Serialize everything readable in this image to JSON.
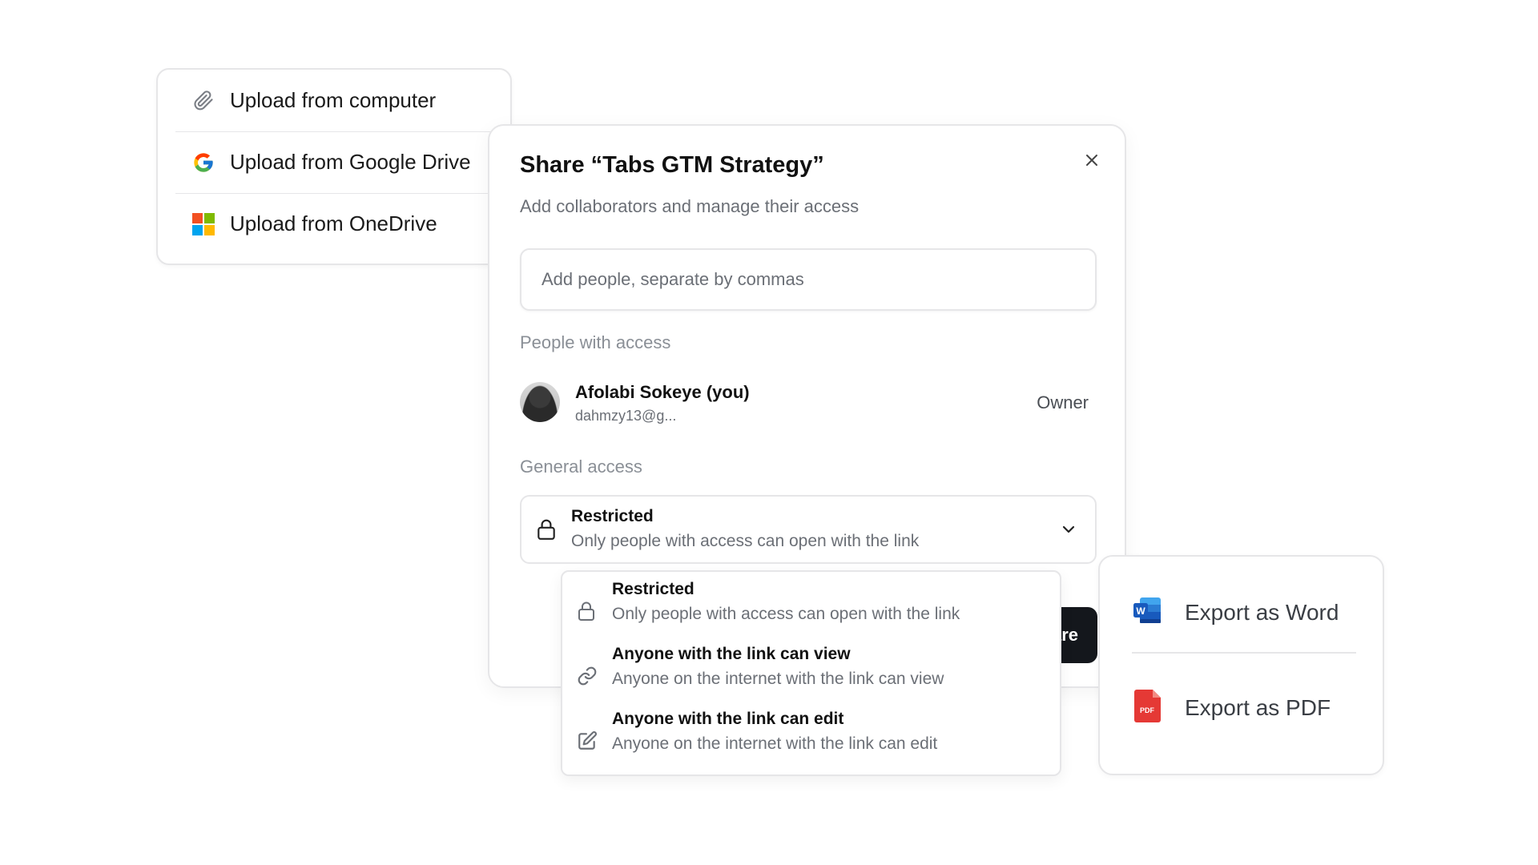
{
  "upload_menu": {
    "items": [
      {
        "label": "Upload from computer",
        "icon": "paperclip-icon"
      },
      {
        "label": "Upload from Google Drive",
        "icon": "google-drive-icon"
      },
      {
        "label": "Upload from OneDrive",
        "icon": "microsoft-icon"
      }
    ]
  },
  "share_dialog": {
    "title": "Share “Tabs GTM Strategy”",
    "subtitle": "Add collaborators and manage their access",
    "input_placeholder": "Add people, separate by commas",
    "people_label": "People with access",
    "person": {
      "name": "Afolabi Sokeye (you)",
      "email": "dahmzy13@g...",
      "role": "Owner"
    },
    "general_label": "General access",
    "selected_access": {
      "title": "Restricted",
      "description": "Only people with access can open with the link"
    },
    "share_button_label": "Share"
  },
  "access_options": [
    {
      "title": "Restricted",
      "description": "Only people with access can open with the link",
      "icon": "lock-icon"
    },
    {
      "title": "Anyone with the link can view",
      "description": "Anyone on the internet with the link can view",
      "icon": "link-icon"
    },
    {
      "title": "Anyone with the link can edit",
      "description": "Anyone on the internet with the link can edit",
      "icon": "edit-icon"
    }
  ],
  "export_menu": {
    "items": [
      {
        "label": "Export as Word",
        "icon": "word-icon"
      },
      {
        "label": "Export as PDF",
        "icon": "pdf-icon"
      }
    ]
  },
  "colors": {
    "primary_button": "#14171c",
    "border": "#e6e6e8",
    "muted_text": "#6b6f76",
    "pdf_red": "#e53935",
    "word_blue": "#2b5797"
  }
}
